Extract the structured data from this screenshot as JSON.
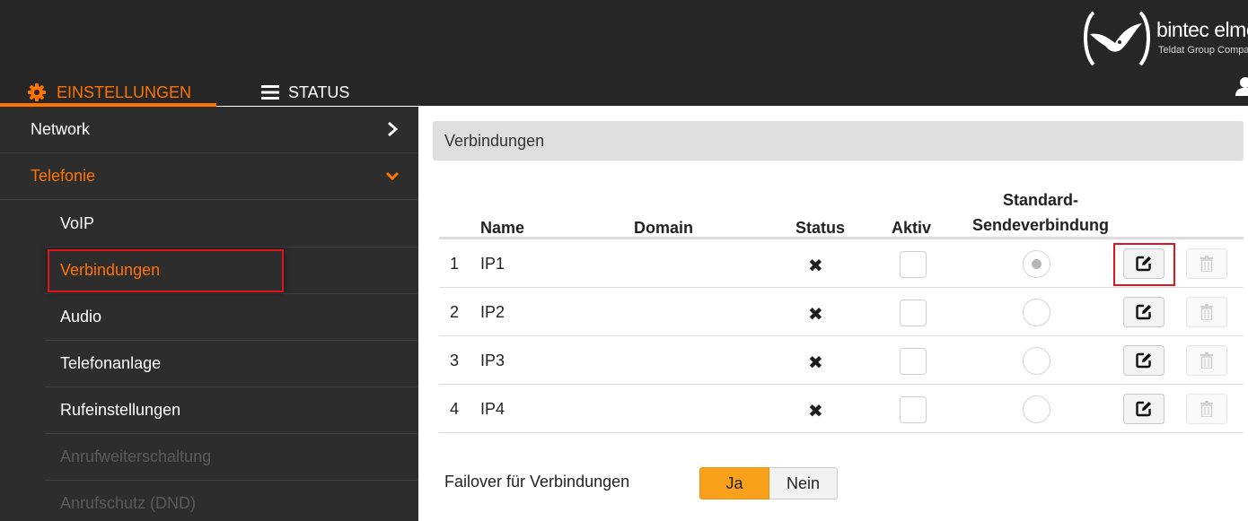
{
  "brand": {
    "name": "bintec elmeg",
    "subtitle": "Teldat Group Company"
  },
  "tabs": [
    {
      "label": "EINSTELLUNGEN",
      "icon": "gear-icon",
      "active": true
    },
    {
      "label": "STATUS",
      "icon": "menu-icon",
      "active": false
    }
  ],
  "sidebar": {
    "items": [
      {
        "label": "Network",
        "level": 1,
        "icon": "chevron-right-icon"
      },
      {
        "label": "Telefonie",
        "level": 1,
        "icon": "chevron-down-icon",
        "expanded": true
      },
      {
        "label": "VoIP",
        "level": 2
      },
      {
        "label": "Verbindungen",
        "level": 2,
        "selected": true
      },
      {
        "label": "Audio",
        "level": 2
      },
      {
        "label": "Telefonanlage",
        "level": 2
      },
      {
        "label": "Rufeinstellungen",
        "level": 2
      },
      {
        "label": "Anrufweiterschaltung",
        "level": 2,
        "disabled": true
      },
      {
        "label": "Anrufschutz (DND)",
        "level": 2,
        "disabled": true
      }
    ]
  },
  "main": {
    "section_title": "Verbindungen",
    "columns": {
      "name": "Name",
      "domain": "Domain",
      "status": "Status",
      "aktiv": "Aktiv",
      "standard_line1": "Standard-",
      "standard_line2": "Sendeverbindung"
    },
    "rows": [
      {
        "num": "1",
        "name": "IP1",
        "domain": "",
        "status": "✖",
        "aktiv": false,
        "standard": true
      },
      {
        "num": "2",
        "name": "IP2",
        "domain": "",
        "status": "✖",
        "aktiv": false,
        "standard": false
      },
      {
        "num": "3",
        "name": "IP3",
        "domain": "",
        "status": "✖",
        "aktiv": false,
        "standard": false
      },
      {
        "num": "4",
        "name": "IP4",
        "domain": "",
        "status": "✖",
        "aktiv": false,
        "standard": false
      }
    ],
    "failover": {
      "label": "Failover für Verbindungen",
      "yes": "Ja",
      "no": "Nein",
      "selected": "Ja"
    }
  },
  "colors": {
    "accent": "#ff7300",
    "topbar": "#262626",
    "sidebar": "#2d2d2d",
    "highlight": "#e0141e",
    "toggle_on": "#f9a11b"
  }
}
